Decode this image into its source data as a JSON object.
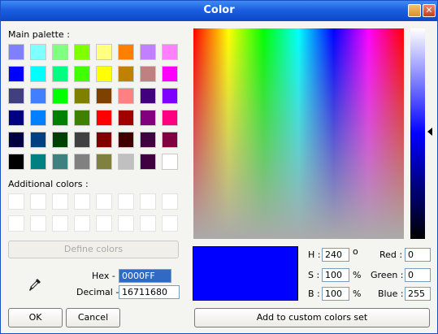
{
  "window": {
    "title": "Color"
  },
  "main_palette": {
    "label": "Main palette :",
    "rows": [
      [
        "#8080ff",
        "#80ffff",
        "#80ff80",
        "#80ff00",
        "#ffff80",
        "#ff8000",
        "#c080ff",
        "#ff80ff"
      ],
      [
        "#0000ff",
        "#00ffff",
        "#00ff80",
        "#40ff00",
        "#ffff00",
        "#c08000",
        "#c08080",
        "#ff00ff"
      ],
      [
        "#404080",
        "#4080ff",
        "#00ff00",
        "#808000",
        "#804000",
        "#ff8080",
        "#400080",
        "#8000ff"
      ],
      [
        "#000080",
        "#0080ff",
        "#008000",
        "#408000",
        "#ff0000",
        "#a00000",
        "#800080",
        "#ff0080"
      ],
      [
        "#000040",
        "#004080",
        "#004000",
        "#404040",
        "#800000",
        "#400000",
        "#400040",
        "#800040"
      ],
      [
        "#000000",
        "#008080",
        "#408080",
        "#808080",
        "#808040",
        "#c0c0c0",
        "#400040",
        "#ffffff"
      ]
    ]
  },
  "additional": {
    "label": "Additional colors :"
  },
  "define_button": "Define colors",
  "hex": {
    "label": "Hex -",
    "value": "0000FF"
  },
  "decimal": {
    "label": "Decimal -",
    "value": "16711680"
  },
  "buttons": {
    "ok": "OK",
    "cancel": "Cancel",
    "add_custom": "Add to custom colors set"
  },
  "hsb": {
    "h_label": "H :",
    "h_value": "240",
    "h_unit": "o",
    "s_label": "S :",
    "s_value": "100",
    "s_unit": "%",
    "b_label": "B :",
    "b_value": "100",
    "b_unit": "%"
  },
  "rgb": {
    "r_label": "Red :",
    "r_value": "0",
    "g_label": "Green :",
    "g_value": "0",
    "b_label": "Blue :",
    "b_value": "255"
  },
  "current_color": "#0000ff",
  "icons": {
    "dropper": "eyedropper-icon",
    "minimize": "minimize-icon",
    "close": "close-icon"
  }
}
